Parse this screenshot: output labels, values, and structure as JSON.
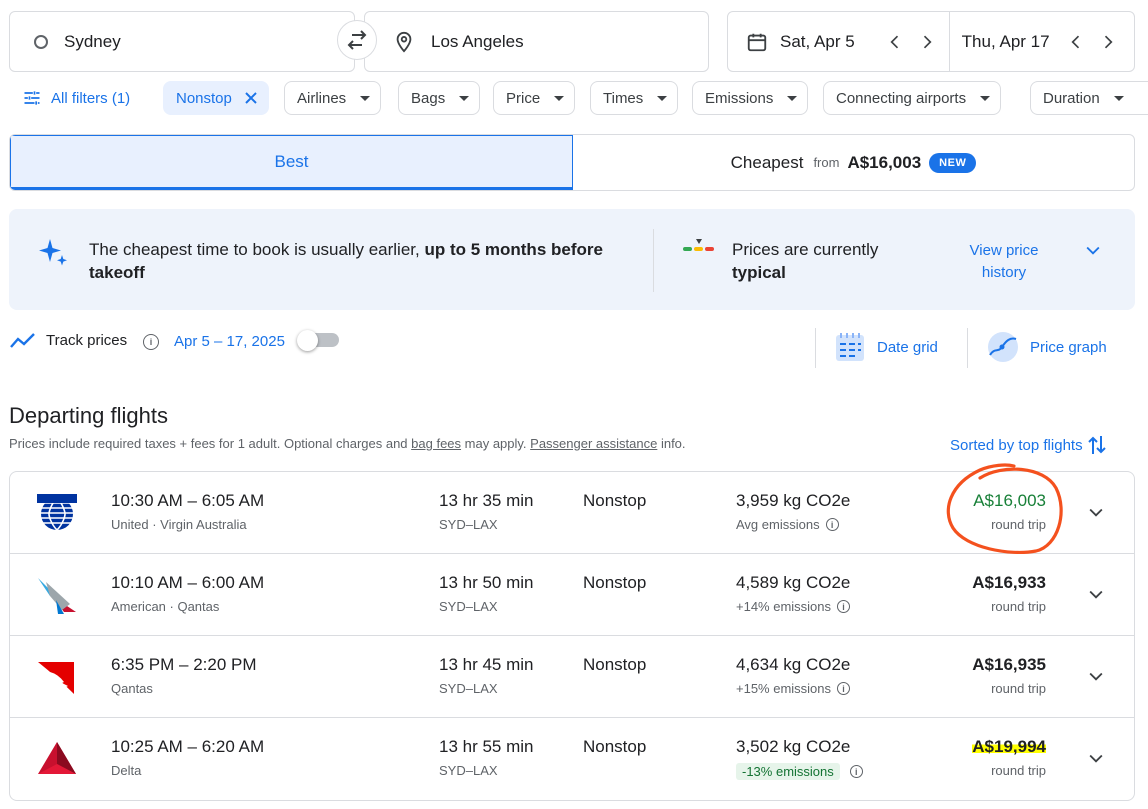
{
  "search": {
    "origin": "Sydney",
    "destination": "Los Angeles",
    "depart_date": "Sat, Apr 5",
    "return_date": "Thu, Apr 17"
  },
  "filters": {
    "all_filters": "All filters (1)",
    "chips": [
      "Nonstop",
      "Airlines",
      "Bags",
      "Price",
      "Times",
      "Emissions",
      "Connecting airports",
      "Duration"
    ]
  },
  "tabs": {
    "best": "Best",
    "cheapest": "Cheapest",
    "from": "from",
    "cheapest_price": "A$16,003",
    "new_badge": "NEW"
  },
  "insight": {
    "book_text": "The cheapest time to book is usually earlier, ",
    "book_bold": "up to 5 months before takeoff",
    "prices_text": "Prices are currently",
    "prices_bold": "typical",
    "history_link_1": "View price",
    "history_link_2": "history"
  },
  "track": {
    "label": "Track prices",
    "dates": "Apr 5 – 17, 2025",
    "date_grid": "Date grid",
    "price_graph": "Price graph"
  },
  "section": {
    "title": "Departing flights",
    "note_1": "Prices include required taxes + fees for 1 adult. Optional charges and ",
    "bag_fees": "bag fees",
    "note_2": " may apply. ",
    "passenger_assistance": "Passenger assistance",
    "note_3": " info.",
    "sorted": "Sorted by top flights"
  },
  "flights": [
    {
      "times": "10:30 AM – 6:05 AM",
      "airline": "United · Virgin Australia",
      "duration": "13 hr 35 min",
      "route": "SYD–LAX",
      "stops": "Nonstop",
      "co2": "3,959 kg CO2e",
      "emissions": "Avg emissions",
      "price": "A$16,003",
      "trip": "round trip",
      "price_color": "#188038"
    },
    {
      "times": "10:10 AM – 6:00 AM",
      "airline": "American · Qantas",
      "duration": "13 hr 50 min",
      "route": "SYD–LAX",
      "stops": "Nonstop",
      "co2": "4,589 kg CO2e",
      "emissions": "+14% emissions",
      "price": "A$16,933",
      "trip": "round trip",
      "price_color": "#202124"
    },
    {
      "times": "6:35 PM – 2:20 PM",
      "airline": "Qantas",
      "duration": "13 hr 45 min",
      "route": "SYD–LAX",
      "stops": "Nonstop",
      "co2": "4,634 kg CO2e",
      "emissions": "+15% emissions",
      "price": "A$16,935",
      "trip": "round trip",
      "price_color": "#202124"
    },
    {
      "times": "10:25 AM – 6:20 AM",
      "airline": "Delta",
      "duration": "13 hr 55 min",
      "route": "SYD–LAX",
      "stops": "Nonstop",
      "co2": "3,502 kg CO2e",
      "emissions": "-13% emissions",
      "price": "A$19,994",
      "trip": "round trip",
      "price_color": "#202124"
    }
  ],
  "colors": {
    "accent": "#1a73e8",
    "annotation_circle": "#f4511e",
    "highlight": "#ffff00"
  }
}
